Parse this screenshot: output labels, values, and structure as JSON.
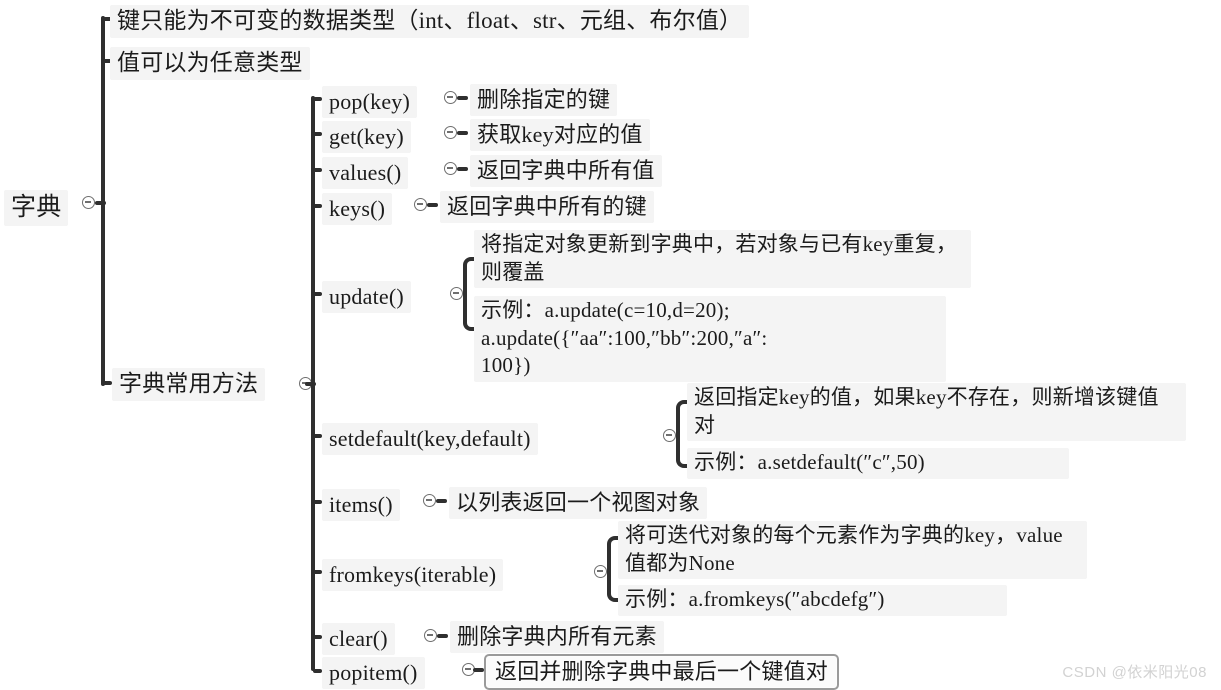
{
  "diagram": {
    "type": "mind-map",
    "title": "字典",
    "root": {
      "label": "字典"
    },
    "level1": [
      {
        "label": "键只能为不可变的数据类型（int、float、str、元组、布尔值）"
      },
      {
        "label": "值可以为任意类型"
      },
      {
        "label": "字典常用方法"
      }
    ],
    "methods": [
      {
        "name": "pop(key)",
        "desc": "删除指定的键"
      },
      {
        "name": "get(key)",
        "desc": "获取key对应的值"
      },
      {
        "name": "values()",
        "desc": "返回字典中所有值"
      },
      {
        "name": "keys()",
        "desc": "返回字典中所有的键"
      },
      {
        "name": "update()",
        "desc": "将指定对象更新到字典中，若对象与已有key重复，则覆盖",
        "example": "示例：a.update(c=10,d=20);\na.update({″aa″:100,″bb″:200,″a″:\n100})"
      },
      {
        "name": "setdefault(key,default)",
        "desc": "返回指定key的值，如果key不存在，则新增该键值对",
        "example": "示例：a.setdefault(″c″,50)"
      },
      {
        "name": "items()",
        "desc": "以列表返回一个视图对象"
      },
      {
        "name": "fromkeys(iterable)",
        "desc": "将可迭代对象的每个元素作为字典的key，value值都为None",
        "example": "示例：a.fromkeys(″abcdefg″)"
      },
      {
        "name": "clear()",
        "desc": "删除字典内所有元素"
      },
      {
        "name": "popitem()",
        "desc": "返回并删除字典中最后一个键值对",
        "selected": true
      }
    ],
    "colors": {
      "node_background": "#f4f4f4",
      "text": "#1b1b1b",
      "branch_line": "#2f2f2f",
      "knob_stroke": "#6f6f6f",
      "selection_border": "#9a9a9a",
      "canvas": "#ffffff",
      "watermark": "#d2d2d2"
    }
  },
  "watermark": {
    "text": "CSDN @依米阳光08"
  }
}
